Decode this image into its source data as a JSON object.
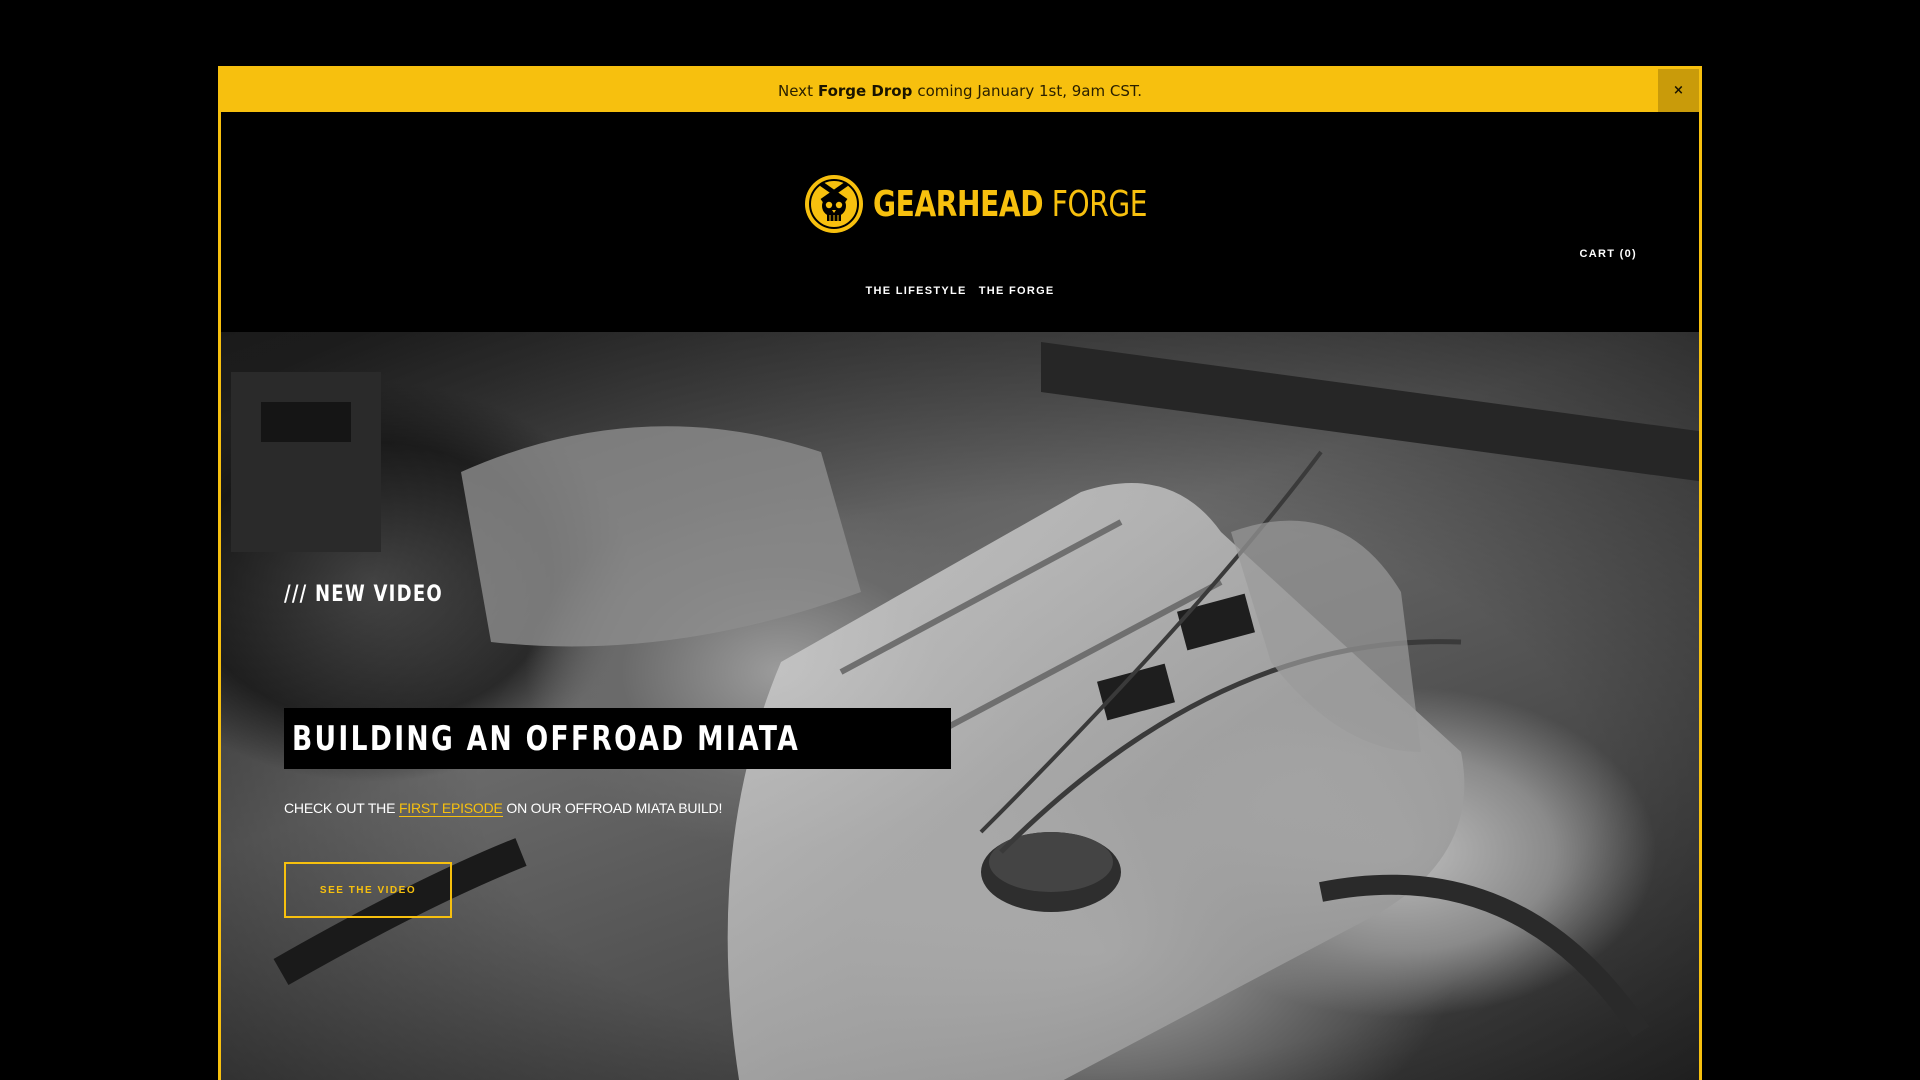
{
  "announcement": {
    "prefix": "Next",
    "bold": "Forge Drop",
    "suffix": "coming January 1st, 9am CST.",
    "close": "×"
  },
  "brand": {
    "name_bold": "GEARHEAD",
    "name_light": "FORGE",
    "logo_icon": "piston-skull-icon",
    "color": "#f7c00e"
  },
  "nav": {
    "items": [
      "THE LIFESTYLE",
      "THE FORGE"
    ]
  },
  "cart": {
    "label": "CART (0)"
  },
  "hero": {
    "kicker": "/// NEW VIDEO",
    "headline": "BUILDING AN OFFROAD MIATA",
    "sub_before": "CHECK OUT THE",
    "sub_link": "FIRST EPISODE",
    "sub_after": "ON OUR OFFROAD MIATA BUILD!",
    "cta": "SEE THE VIDEO"
  }
}
